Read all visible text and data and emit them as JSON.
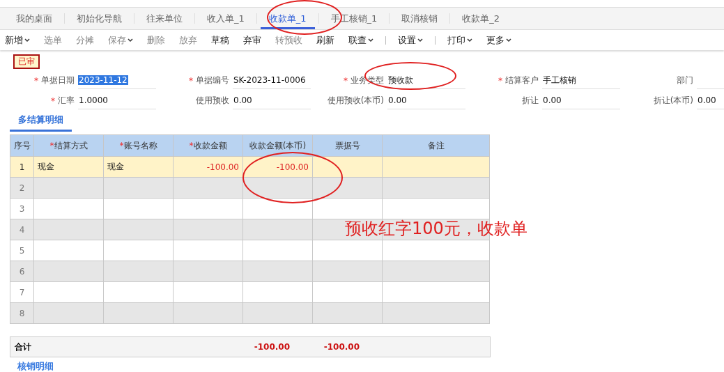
{
  "tabs": [
    {
      "label": "我的桌面",
      "selected": false
    },
    {
      "label": "初始化导航",
      "selected": false
    },
    {
      "label": "往来单位",
      "selected": false
    },
    {
      "label": "收入单_1",
      "selected": false
    },
    {
      "label": "收款单_1",
      "selected": true
    },
    {
      "label": "手工核销_1",
      "selected": false
    },
    {
      "label": "取消核销",
      "selected": false
    },
    {
      "label": "收款单_2",
      "selected": false
    }
  ],
  "toolbar": [
    {
      "kind": "button",
      "label": "新增",
      "dropdown": true,
      "disabled": false
    },
    {
      "kind": "button",
      "label": "选单",
      "dropdown": false,
      "disabled": true
    },
    {
      "kind": "button",
      "label": "分摊",
      "dropdown": false,
      "disabled": true
    },
    {
      "kind": "button",
      "label": "保存",
      "dropdown": true,
      "disabled": true
    },
    {
      "kind": "button",
      "label": "删除",
      "dropdown": false,
      "disabled": true
    },
    {
      "kind": "button",
      "label": "放弃",
      "dropdown": false,
      "disabled": true
    },
    {
      "kind": "button",
      "label": "草稿",
      "dropdown": false,
      "disabled": false
    },
    {
      "kind": "button",
      "label": "弃审",
      "dropdown": false,
      "disabled": false
    },
    {
      "kind": "button",
      "label": "转预收",
      "dropdown": false,
      "disabled": true
    },
    {
      "kind": "button",
      "label": "刷新",
      "dropdown": false,
      "disabled": false
    },
    {
      "kind": "button",
      "label": "联查",
      "dropdown": true,
      "disabled": false
    },
    {
      "kind": "separator"
    },
    {
      "kind": "button",
      "label": "设置",
      "dropdown": true,
      "disabled": false
    },
    {
      "kind": "separator"
    },
    {
      "kind": "button",
      "label": "打印",
      "dropdown": true,
      "disabled": false
    },
    {
      "kind": "button",
      "label": "更多",
      "dropdown": true,
      "disabled": false
    }
  ],
  "status_badge": "已审",
  "form_rows": [
    [
      {
        "marker": "*",
        "label": "单据日期",
        "value": "2023-11-12",
        "highlighted": true
      },
      {
        "marker": "*",
        "label": "单据编号",
        "value": "SK-2023-11-0006"
      },
      {
        "marker": "*",
        "label": "业务类型",
        "value": "预收款"
      },
      {
        "marker": "*",
        "label": "结算客户",
        "value": "手工核销"
      },
      {
        "label": "部门"
      }
    ],
    [
      {
        "marker": "*",
        "label": "汇率",
        "value": "1.0000"
      },
      {
        "label": "使用预收",
        "value": "0.00"
      },
      {
        "label": "使用预收(本币)",
        "value": "0.00"
      },
      {
        "label": "折让",
        "value": "0.00"
      },
      {
        "label": "折让(本币)",
        "value": "0.00"
      }
    ]
  ],
  "section_tab": "多结算明细",
  "table": {
    "columns": [
      {
        "label": "序号"
      },
      {
        "marker": "*",
        "label": "结算方式"
      },
      {
        "marker": "*",
        "label": "账号名称"
      },
      {
        "marker": "*",
        "label": "收款金额"
      },
      {
        "label": "收款金额(本币)"
      },
      {
        "label": "票据号"
      },
      {
        "label": "备注"
      }
    ],
    "rows": [
      {
        "selected": true,
        "cells": [
          "1",
          "现金",
          "现金",
          "-100.00",
          "-100.00"
        ]
      },
      {
        "selected": false,
        "cells": [
          "2"
        ]
      },
      {
        "selected": false,
        "cells": [
          "3"
        ]
      },
      {
        "selected": false,
        "cells": [
          "4"
        ]
      },
      {
        "selected": false,
        "cells": [
          "5"
        ]
      },
      {
        "selected": false,
        "cells": [
          "6"
        ]
      },
      {
        "selected": false,
        "cells": [
          "7"
        ]
      },
      {
        "selected": false,
        "cells": [
          "8"
        ]
      }
    ],
    "total": {
      "label": "合计",
      "values": [
        "-100.00",
        "-100.00"
      ]
    }
  },
  "bottom_section": "核销明细",
  "annotation": "预收红字100元，收款单"
}
